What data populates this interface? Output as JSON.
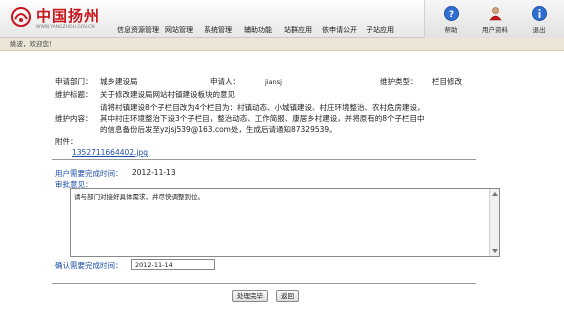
{
  "header": {
    "logo_title": "中国扬州",
    "logo_url": "WWW.YANGZHOU.GOV.CN",
    "nav": [
      {
        "label": "信息资源管理"
      },
      {
        "label": "网站管理"
      },
      {
        "label": "系统管理"
      },
      {
        "label": "辅助功能"
      },
      {
        "label": "站群应用"
      },
      {
        "label": "依申请公开"
      },
      {
        "label": "子站应用"
      }
    ],
    "actions": [
      {
        "label": "帮助",
        "icon": "help-icon"
      },
      {
        "label": "用户资料",
        "icon": "user-profile-icon"
      },
      {
        "label": "退出",
        "icon": "logout-icon"
      }
    ],
    "colors": {
      "brand_red": "#c8161d",
      "link_blue": "#1d4fa8"
    }
  },
  "breadcrumb": {
    "text": "姚波，欢迎您！"
  },
  "form": {
    "dept_label": "申请部门：",
    "dept_value": "城乡建设局",
    "applicant_label": "申请人：",
    "applicant_value": "jiansj",
    "type_label": "维护类型：",
    "type_value": "栏目修改",
    "title_label": "维护标题：",
    "title_value": "关于修改建设局网站村镇建设板块的意见",
    "content_label": "维护内容：",
    "content_lines": [
      "请将村镇建设8个子栏目改为4个栏目为：村镇动态、小城镇建设、村庄环境整治、农村危房建设，",
      "其中村庄环境整治下设3个子栏目，整治动态、工作简报、康居乡村建设，并将原有的8个子栏目中",
      "的信息备份后发至yzjsj539@163.com处，生成后请通知87329539。"
    ],
    "attachment_label": "附件：",
    "attachment_link": "1352711664402.jpg",
    "due_label": "用户需要完成时间：",
    "due_value": "2012-11-13",
    "review_label": "审批意见：",
    "review_text": "请与部门对接好具体需求，并尽快调整到位。",
    "confirm_label": "确认需要完成时间：",
    "confirm_value": "2012-11-14",
    "submit_label": "处理完毕",
    "back_label": "返回"
  }
}
